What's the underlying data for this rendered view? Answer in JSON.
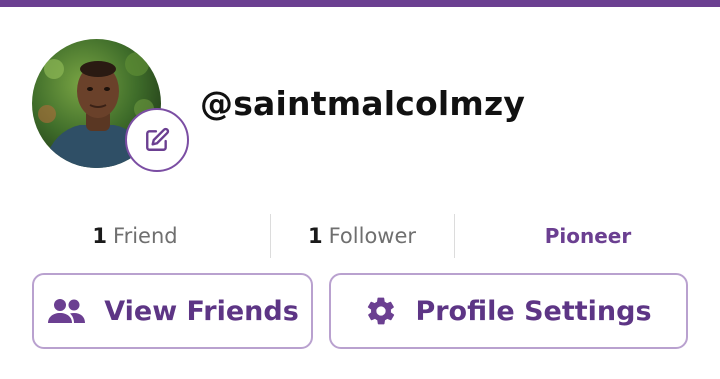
{
  "profile": {
    "username": "@saintmalcolmzy",
    "avatar_icon": "profile-photo",
    "edit_icon": "pencil-square-icon"
  },
  "stats": {
    "friends_count": "1",
    "friends_label": "Friend",
    "followers_count": "1",
    "followers_label": "Follower",
    "badge": "Pioneer"
  },
  "actions": {
    "view_friends_label": "View Friends",
    "view_friends_icon": "people-icon",
    "profile_settings_label": "Profile Settings",
    "profile_settings_icon": "gear-icon"
  },
  "colors": {
    "accent": "#6b3f91",
    "button_border": "#b9a1cf",
    "button_text": "#5d3585"
  }
}
